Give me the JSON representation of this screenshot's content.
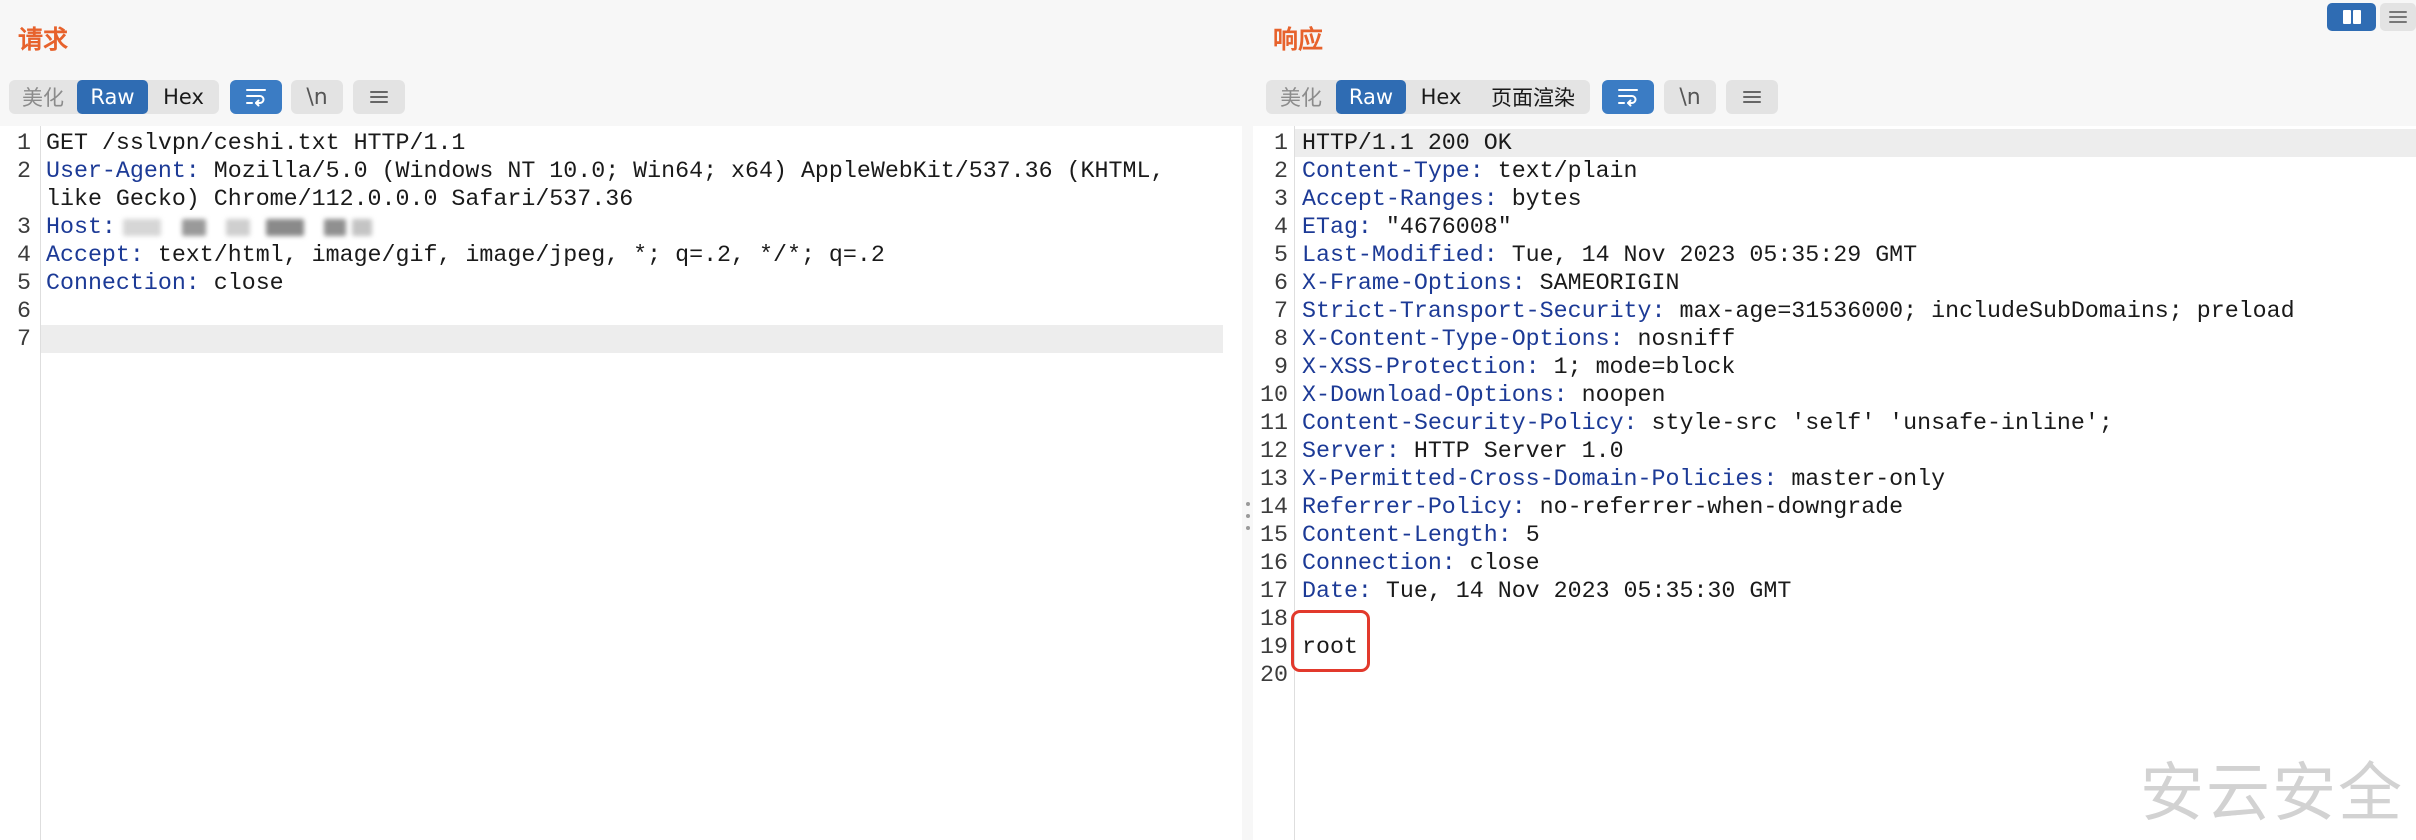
{
  "layout_toggle": {
    "buttons": [
      {
        "icon": "columns-layout-icon",
        "active": true
      },
      {
        "icon": "rows-layout-icon",
        "active": false
      }
    ]
  },
  "request": {
    "title": "请求",
    "view_tabs": [
      {
        "label": "美化",
        "active": false,
        "disabled": true
      },
      {
        "label": "Raw",
        "active": true,
        "disabled": false
      },
      {
        "label": "Hex",
        "active": false,
        "disabled": false
      }
    ],
    "tools": [
      {
        "icon": "wrap-lines-icon",
        "active": true
      },
      {
        "label": "\\n",
        "active": false
      },
      {
        "icon": "hamburger-menu-icon",
        "active": false
      }
    ],
    "lines": [
      {
        "n": "1",
        "text": "GET /sslvpn/ceshi.txt HTTP/1.1"
      },
      {
        "n": "2",
        "key": "User-Agent:",
        "value": "Mozilla/5.0 (Windows NT 10.0; Win64; x64) AppleWebKit/537.36 (KHTML, like Gecko) Chrome/112.0.0.0 Safari/537.36"
      },
      {
        "n": "3",
        "key": "Host:",
        "value_redacted": true
      },
      {
        "n": "4",
        "key": "Accept:",
        "value": "text/html, image/gif, image/jpeg, *; q=.2, */*; q=.2"
      },
      {
        "n": "5",
        "key": "Connection:",
        "value": "close"
      },
      {
        "n": "6",
        "text": ""
      },
      {
        "n": "7",
        "text": "",
        "highlighted": true
      }
    ]
  },
  "response": {
    "title": "响应",
    "view_tabs": [
      {
        "label": "美化",
        "active": false,
        "disabled": true
      },
      {
        "label": "Raw",
        "active": true,
        "disabled": false
      },
      {
        "label": "Hex",
        "active": false,
        "disabled": false
      },
      {
        "label": "页面渲染",
        "active": false,
        "disabled": false
      }
    ],
    "tools": [
      {
        "icon": "wrap-lines-icon",
        "active": true
      },
      {
        "label": "\\n",
        "active": false
      },
      {
        "icon": "hamburger-menu-icon",
        "active": false
      }
    ],
    "lines": [
      {
        "n": "1",
        "text": "HTTP/1.1 200 OK",
        "highlighted": true
      },
      {
        "n": "2",
        "key": "Content-Type:",
        "value": "text/plain"
      },
      {
        "n": "3",
        "key": "Accept-Ranges:",
        "value": "bytes"
      },
      {
        "n": "4",
        "key": "ETag:",
        "value": "\"4676008\""
      },
      {
        "n": "5",
        "key": "Last-Modified:",
        "value": "Tue, 14 Nov 2023 05:35:29 GMT"
      },
      {
        "n": "6",
        "key": "X-Frame-Options:",
        "value": "SAMEORIGIN"
      },
      {
        "n": "7",
        "key": "Strict-Transport-Security:",
        "value": "max-age=31536000; includeSubDomains; preload"
      },
      {
        "n": "8",
        "key": "X-Content-Type-Options:",
        "value": "nosniff"
      },
      {
        "n": "9",
        "key": "X-XSS-Protection:",
        "value": "1; mode=block"
      },
      {
        "n": "10",
        "key": "X-Download-Options:",
        "value": "noopen"
      },
      {
        "n": "11",
        "key": "Content-Security-Policy:",
        "value": "style-src 'self' 'unsafe-inline';"
      },
      {
        "n": "12",
        "key": "Server:",
        "value": "HTTP Server 1.0"
      },
      {
        "n": "13",
        "key": "X-Permitted-Cross-Domain-Policies:",
        "value": "master-only"
      },
      {
        "n": "14",
        "key": "Referrer-Policy:",
        "value": "no-referrer-when-downgrade"
      },
      {
        "n": "15",
        "key": "Content-Length:",
        "value": "5"
      },
      {
        "n": "16",
        "key": "Connection:",
        "value": "close"
      },
      {
        "n": "17",
        "key": "Date:",
        "value": "Tue, 14 Nov 2023 05:35:30 GMT"
      },
      {
        "n": "18",
        "text": ""
      },
      {
        "n": "19",
        "text": "root",
        "boxed": true
      },
      {
        "n": "20",
        "text": ""
      }
    ]
  },
  "watermark": "安云安全",
  "colors": {
    "title": "#e7622c",
    "active": "#2f6cb3",
    "active_tool": "#3b7cc4",
    "header_key": "#1c3a96",
    "annotation": "#e2392c"
  }
}
